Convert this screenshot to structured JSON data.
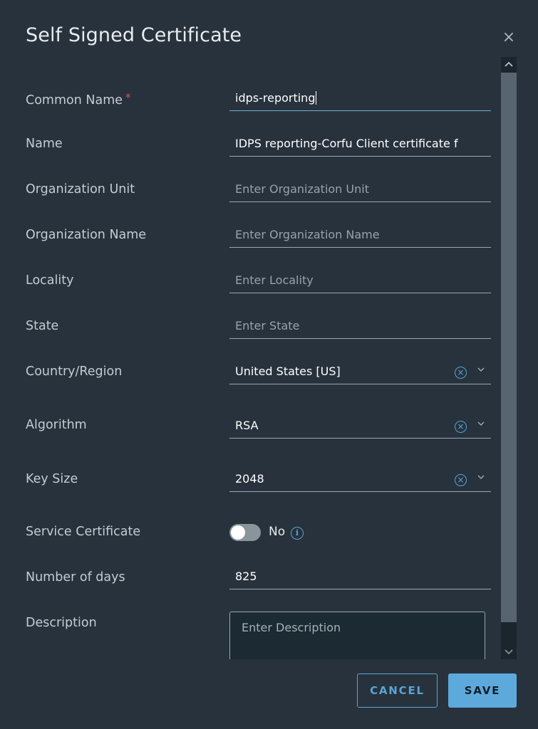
{
  "dialog": {
    "title": "Self Signed Certificate",
    "close_glyph": "×"
  },
  "fields": {
    "common_name": {
      "label": "Common Name",
      "required_mark": "*",
      "value": "idps-reporting"
    },
    "name": {
      "label": "Name",
      "value": "IDPS reporting-Corfu Client certificate f"
    },
    "organization_unit": {
      "label": "Organization Unit",
      "placeholder": "Enter Organization Unit"
    },
    "organization_name": {
      "label": "Organization Name",
      "placeholder": "Enter Organization Name"
    },
    "locality": {
      "label": "Locality",
      "placeholder": "Enter Locality"
    },
    "state": {
      "label": "State",
      "placeholder": "Enter State"
    },
    "country_region": {
      "label": "Country/Region",
      "value": "United States [US]"
    },
    "algorithm": {
      "label": "Algorithm",
      "value": "RSA"
    },
    "key_size": {
      "label": "Key Size",
      "value": "2048"
    },
    "service_certificate": {
      "label": "Service Certificate",
      "toggle_state": "No",
      "enabled": false
    },
    "number_of_days": {
      "label": "Number of days",
      "value": "825"
    },
    "description": {
      "label": "Description",
      "placeholder": "Enter Description"
    }
  },
  "icons": {
    "clear": "clear-circle-icon",
    "dropdown": "chevron-down-icon",
    "info": "info-icon",
    "close": "close-icon"
  },
  "buttons": {
    "cancel_label": "CANCEL",
    "save_label": "SAVE"
  },
  "colors": {
    "background": "#27323c",
    "accent": "#5ea9dc",
    "required": "#e0544a"
  }
}
